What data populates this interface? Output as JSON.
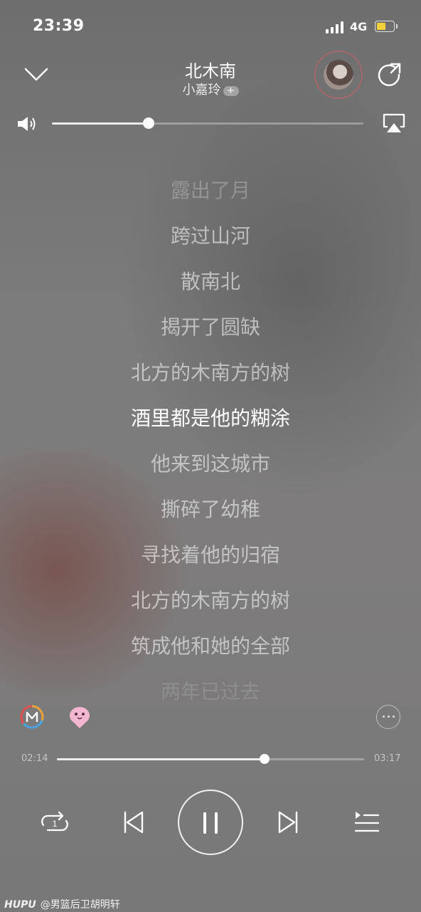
{
  "status_bar": {
    "time": "23:39",
    "network": "4G"
  },
  "header": {
    "song_title": "北木南",
    "artist": "小嘉玲",
    "artist_badge": "+"
  },
  "volume": {
    "level": 0.31
  },
  "lyrics": [
    {
      "text": "露出了月",
      "state": "fade1"
    },
    {
      "text": "跨过山河",
      "state": "normal"
    },
    {
      "text": "散南北",
      "state": "normal"
    },
    {
      "text": "揭开了圆缺",
      "state": "normal"
    },
    {
      "text": "北方的木南方的树",
      "state": "normal"
    },
    {
      "text": "酒里都是他的糊涂",
      "state": "current"
    },
    {
      "text": "他来到这城市",
      "state": "normal"
    },
    {
      "text": "撕碎了幼稚",
      "state": "normal"
    },
    {
      "text": "寻找着他的归宿",
      "state": "normal"
    },
    {
      "text": "北方的木南方的树",
      "state": "normal"
    },
    {
      "text": "筑成他和她的全部",
      "state": "normal"
    },
    {
      "text": "两年已过去",
      "state": "fade2"
    }
  ],
  "playback": {
    "current_time": "02:14",
    "total_time": "03:17",
    "progress": 0.677
  },
  "controls": {
    "repeat_badge": "1",
    "icons": [
      "chevron-down-icon",
      "share-icon",
      "volume-icon",
      "airplay-icon",
      "mv-icon",
      "bird-icon",
      "more-icon",
      "repeat-one-icon",
      "previous-icon",
      "pause-icon",
      "next-icon",
      "playlist-icon"
    ]
  },
  "watermark": {
    "brand": "HUPU",
    "text": "@男篮后卫胡明轩"
  }
}
